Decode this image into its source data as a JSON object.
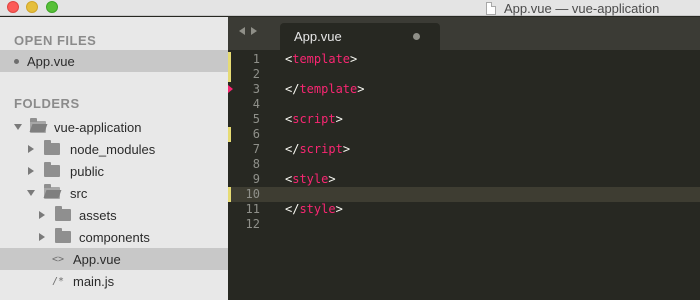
{
  "window": {
    "title": "App.vue — vue-application"
  },
  "sidebar": {
    "open_files_heading": "OPEN FILES",
    "open_files": [
      {
        "label": "App.vue"
      }
    ],
    "folders_heading": "FOLDERS",
    "tree": {
      "root": "vue-application",
      "node_modules": "node_modules",
      "public": "public",
      "src": "src",
      "assets": "assets",
      "components": "components",
      "app_vue": "App.vue",
      "main_js": "main.js"
    }
  },
  "tab": {
    "label": "App.vue"
  },
  "editor": {
    "line_numbers": [
      "1",
      "2",
      "3",
      "4",
      "5",
      "6",
      "7",
      "8",
      "9",
      "10",
      "11",
      "12"
    ],
    "current_line": "10",
    "lines": [
      {
        "open": "<",
        "tag": "template",
        "close": ">"
      },
      {
        "open": "",
        "tag": "",
        "close": ""
      },
      {
        "open": "</",
        "tag": "template",
        "close": ">"
      },
      {
        "open": "",
        "tag": "",
        "close": ""
      },
      {
        "open": "<",
        "tag": "script",
        "close": ">"
      },
      {
        "open": "",
        "tag": "",
        "close": ""
      },
      {
        "open": "</",
        "tag": "script",
        "close": ">"
      },
      {
        "open": "",
        "tag": "",
        "close": ""
      },
      {
        "open": "<",
        "tag": "style",
        "close": ">"
      },
      {
        "open": "",
        "tag": "",
        "close": ""
      },
      {
        "open": "</",
        "tag": "style",
        "close": ">"
      },
      {
        "open": "",
        "tag": "",
        "close": ""
      }
    ]
  },
  "colors": {
    "editor_bg": "#272822",
    "tag": "#f92672",
    "punctuation": "#f8f8f2",
    "gutter_mark": "#e6db74",
    "sidebar_bg": "#e8e8e8"
  }
}
